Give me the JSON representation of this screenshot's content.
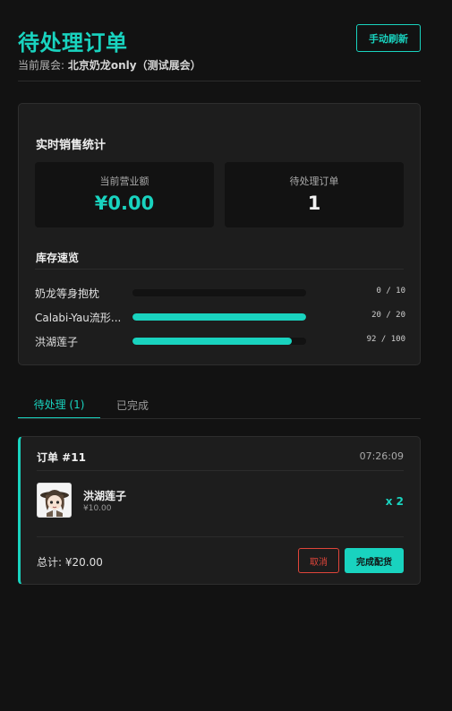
{
  "header": {
    "title": "待处理订单",
    "subtitle_prefix": "当前展会: ",
    "subtitle_event": "北京奶龙only（测试展会）",
    "refresh_label": "手动刷新"
  },
  "stats": {
    "title": "实时销售统计",
    "revenue_label": "当前营业额",
    "revenue_value": "¥0.00",
    "pending_label": "待处理订单",
    "pending_value": "1"
  },
  "inventory": {
    "title": "库存速览",
    "items": [
      {
        "name": "奶龙等身抱枕",
        "count": "0 / 10",
        "fraction": 0.0
      },
      {
        "name": "Calabi-Yau流形...",
        "count": "20 / 20",
        "fraction": 1.0
      },
      {
        "name": "洪湖莲子",
        "count": "92 / 100",
        "fraction": 0.92
      }
    ]
  },
  "tabs": {
    "pending_label": "待处理 (1)",
    "done_label": "已完成"
  },
  "order": {
    "id": "订单 #11",
    "time": "07:26:09",
    "item_name": "洪湖莲子",
    "item_price": "¥10.00",
    "item_qty": "x 2",
    "total": "总计: ¥20.00",
    "cancel_label": "取消",
    "complete_label": "完成配货"
  },
  "colors": {
    "accent": "#19d3bf",
    "danger": "#e0453a",
    "background": "#121212",
    "card": "#1d1d1d"
  }
}
